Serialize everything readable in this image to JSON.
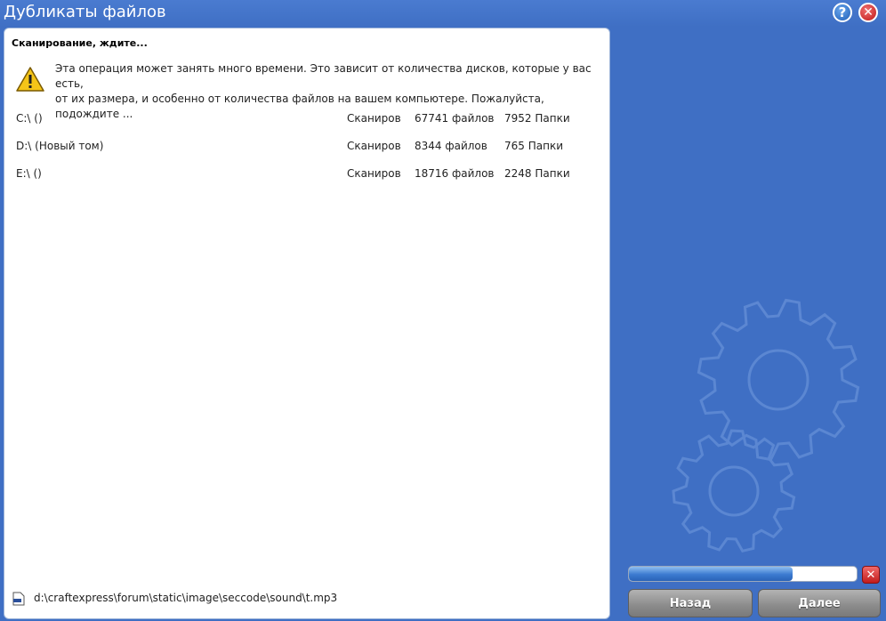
{
  "window": {
    "title": "Дубликаты файлов",
    "help_icon": "question-icon",
    "close_icon": "close-icon",
    "accent": "#3f6fc4"
  },
  "panel": {
    "heading": "Сканирование, ждите...",
    "warning_icon": "warning-icon",
    "description_line1": "Эта операция может занять много времени. Это зависит от количества дисков, которые у вас есть,",
    "description_line2": "от их размера, и особенно от количества файлов на вашем компьютере. Пожалуйста, подождите ..."
  },
  "drives": [
    {
      "name": "C:\\ ()",
      "status": "Сканиров",
      "files": "67741 файлов",
      "folders": "7952 Папки"
    },
    {
      "name": "D:\\ (Новый том)",
      "status": "Сканиров",
      "files": "8344 файлов",
      "folders": "765 Папки"
    },
    {
      "name": "E:\\ ()",
      "status": "Сканиров",
      "files": "18716 файлов",
      "folders": "2248 Папки"
    }
  ],
  "current_file": {
    "icon": "file-icon",
    "path": "d:\\craftexpress\\forum\\static\\image\\seccode\\sound\\t.mp3"
  },
  "progress": {
    "fraction": 0.72,
    "cancel_icon": "cancel-icon"
  },
  "buttons": {
    "back": "Назад",
    "next": "Далее"
  }
}
